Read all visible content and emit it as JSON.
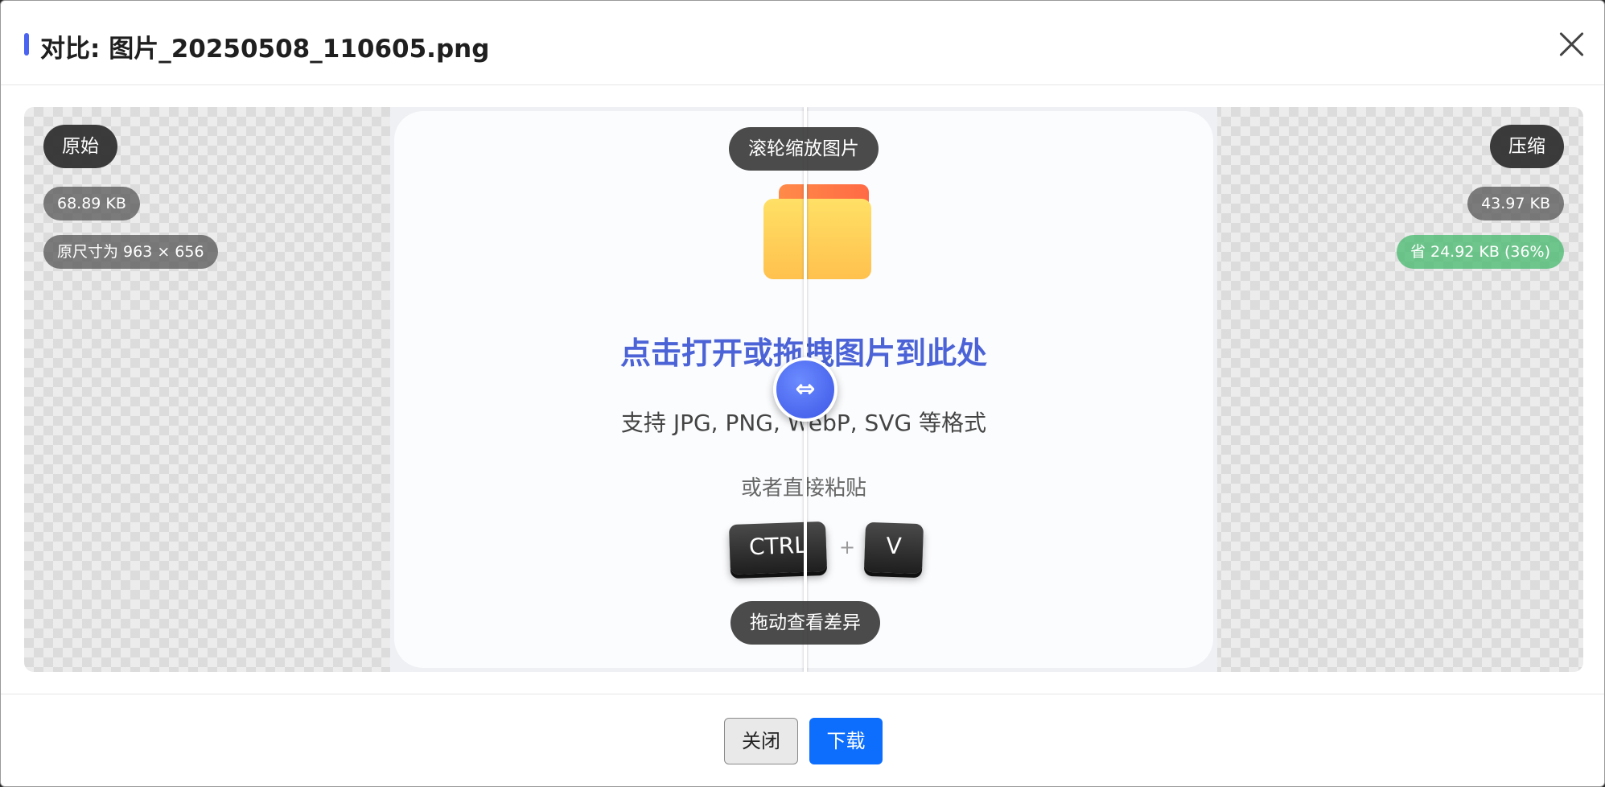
{
  "dialog": {
    "title": "对比: 图片_20250508_110605.png",
    "close_icon": "close-icon"
  },
  "viewer": {
    "left_label": "原始",
    "left_size": "68.89 KB",
    "left_dims": "原尺寸为 963 × 656",
    "right_label": "压缩",
    "right_size": "43.97 KB",
    "right_saved": "省 24.92 KB (36%)",
    "zoom_hint": "滚轮缩放图片",
    "drag_hint": "拖动查看差异",
    "handle_icon": "left-right-arrows-icon"
  },
  "image": {
    "folder_icon": "folder-icon",
    "main_text": "点击打开或拖拽图片到此处",
    "sub_text": "支持 JPG, PNG, WebP, SVG 等格式",
    "paste_text": "或者直接粘贴",
    "key_ctrl": "CTRL",
    "key_plus": "+",
    "key_v": "V"
  },
  "footer": {
    "close_label": "关闭",
    "download_label": "下载"
  },
  "colors": {
    "accent": "#4a63f0",
    "primary_button": "#0d6efd",
    "saved_badge": "#46ba6e"
  }
}
